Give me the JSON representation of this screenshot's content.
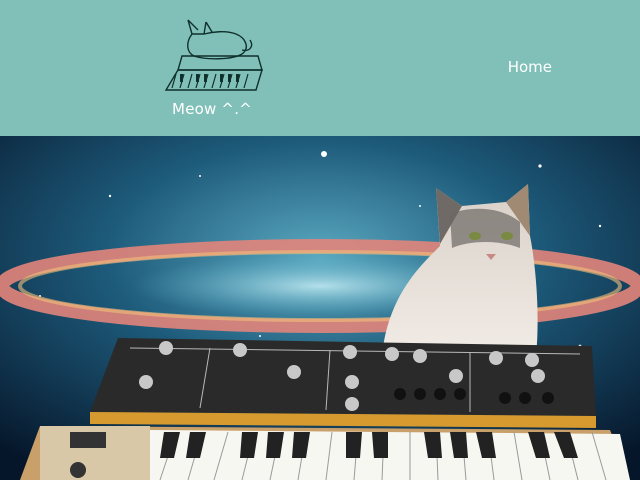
{
  "header": {
    "brand_text": "Meow ^.^",
    "logo_icon": "cat-on-synth-icon",
    "nav": {
      "home_label": "Home"
    }
  },
  "hero": {
    "image": "cat-playing-synthesizer-in-space",
    "colors": {
      "header_bg": "#80c0b8",
      "space": "#0d2a44",
      "nebula": "#e07a6a",
      "synth_body": "#2a2a2a",
      "synth_wood": "#d79a2f"
    }
  }
}
